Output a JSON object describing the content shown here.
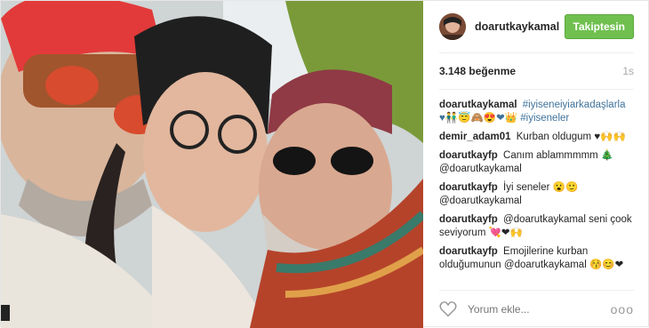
{
  "post": {
    "author": "doarutkaykamal",
    "follow_label": "Takiptesin",
    "likes": "3.148 beğenme",
    "time": "1s"
  },
  "comments": [
    {
      "user": "doarutkaykamal",
      "text": "#iyiseneiyiarkadaşlarla ♥👬😇🙈😍❤👑 #iyiseneler"
    },
    {
      "user": "demir_adam01",
      "text": "Kurban oldugum ♥🙌🙌"
    },
    {
      "user": "doarutkayfp",
      "text": "Canım ablammmmm 🎄 @doarutkaykamal"
    },
    {
      "user": "doarutkayfp",
      "text": "İyi seneler 😮🙂 @doarutkaykamal"
    },
    {
      "user": "doarutkayfp",
      "text": "@doarutkaykamal seni çook seviyorum 💘❤🙌"
    },
    {
      "user": "doarutkayfp",
      "text": "Emojilerine kurban olduğumunun @doarutkaykamal 😚😊❤"
    }
  ],
  "footer": {
    "placeholder": "Yorum ekle...",
    "more": "ooo"
  },
  "icons": {
    "like": "heart-icon",
    "options": "more-options-icon"
  }
}
